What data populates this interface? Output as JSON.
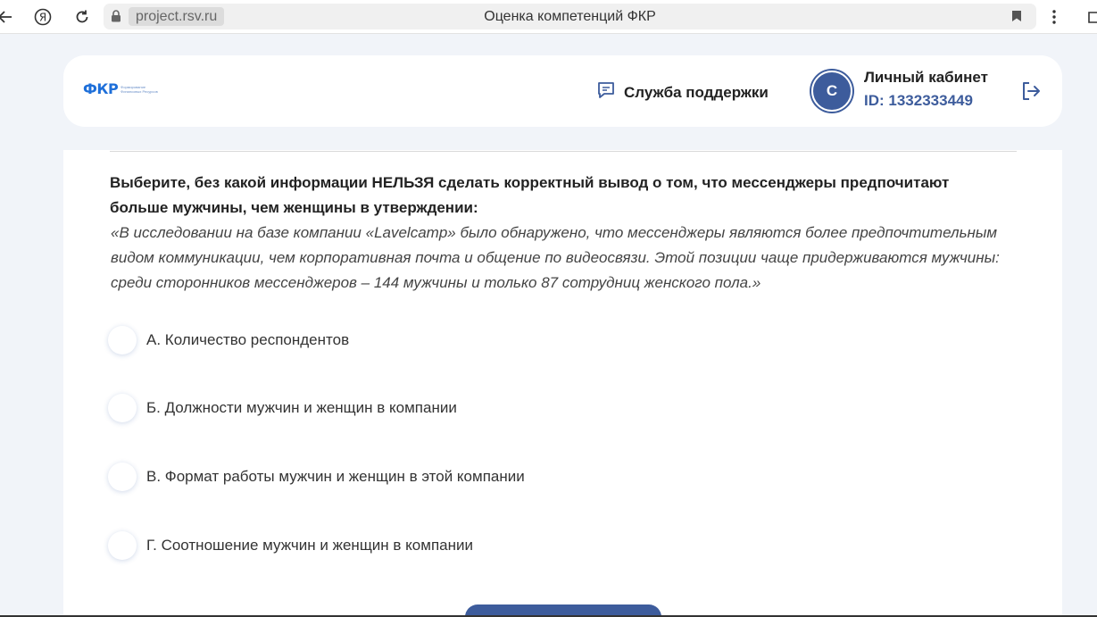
{
  "browser": {
    "url": "project.rsv.ru",
    "page_title": "Оценка компетенций ФКР"
  },
  "header": {
    "logo_text": "ФКР",
    "logo_subtext": "Формирование Финансовых Ресурсов",
    "support_label": "Служба поддержки",
    "avatar_letter": "С",
    "cabinet_title": "Личный кабинет",
    "cabinet_id": "ID: 1332333449"
  },
  "question": {
    "text": "Выберите, без какой информации НЕЛЬЗЯ сделать корректный вывод о том, что мессенджеры предпочитают больше мужчины, чем женщины в утверждении:",
    "quote": "«В исследовании на базе компании «Lavelcamp» было обнаружено, что мессенджеры являются более предпочтительным видом коммуникации, чем корпоративная почта и общение по видеосвязи. Этой позиции чаще придерживаются мужчины: среди сторонников мессенджеров – 144 мужчины и только 87 сотрудниц женского пола.»"
  },
  "options": [
    {
      "label": "А. Количество респондентов"
    },
    {
      "label": "Б. Должности мужчин и женщин в компании"
    },
    {
      "label": "В. Формат работы мужчин и женщин в этой компании"
    },
    {
      "label": "Г. Соотношение мужчин и женщин в компании"
    }
  ],
  "colors": {
    "accent": "#3d5c9c",
    "logo_blue": "#1e6fd9",
    "background": "#f1f4f9"
  }
}
